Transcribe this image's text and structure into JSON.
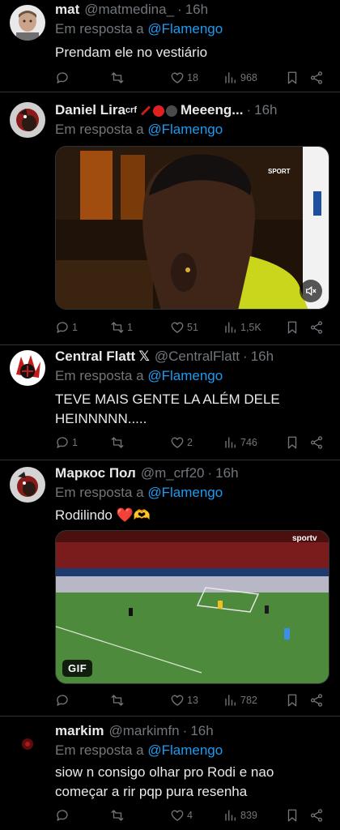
{
  "colors": {
    "background": "#000000",
    "text": "#e7e9ea",
    "muted": "#71767b",
    "link": "#1d9bf0",
    "divider": "#2f3336"
  },
  "replying_prefix": "Em resposta a",
  "tweets": [
    {
      "name": "mat",
      "handle": "@matmedina_",
      "separator": "·",
      "time": "16h",
      "reply_to": "@Flamengo",
      "text": "Prendam ele no vestiário",
      "replies": "",
      "retweets": "",
      "likes": "18",
      "views": "968"
    },
    {
      "name": "Daniel Lira",
      "name_sup": "crf",
      "name_suffix": "Meeeng...",
      "handle": "",
      "separator": "·",
      "time": "16h",
      "reply_to": "@Flamengo",
      "text": "",
      "media_type": "video",
      "media_logo": "SPORT",
      "replies": "1",
      "retweets": "1",
      "likes": "51",
      "views": "1,5K"
    },
    {
      "name": "Central Flatt",
      "name_suffix": "𝕏",
      "handle": "@CentralFlatt",
      "separator": "·",
      "time": "16h",
      "reply_to": "@Flamengo",
      "text": "TEVE MAIS GENTE LA ALÉM DELE HEINNNNN.....",
      "replies": "1",
      "retweets": "",
      "likes": "2",
      "views": "746"
    },
    {
      "name": "Маркос Пол",
      "handle": "@m_crf20",
      "separator": "·",
      "time": "16h",
      "reply_to": "@Flamengo",
      "text": "Rodilindo ❤️🫶",
      "media_type": "gif",
      "media_badge": "GIF",
      "media_logo": "sportv",
      "replies": "",
      "retweets": "",
      "likes": "13",
      "views": "782"
    },
    {
      "name": "markim",
      "handle": "@markimfn",
      "separator": "·",
      "time": "16h",
      "reply_to": "@Flamengo",
      "text": "siow n consigo olhar pro Rodi e nao começar a rir pqp pura resenha",
      "replies": "",
      "retweets": "",
      "likes": "4",
      "views": "839"
    }
  ]
}
